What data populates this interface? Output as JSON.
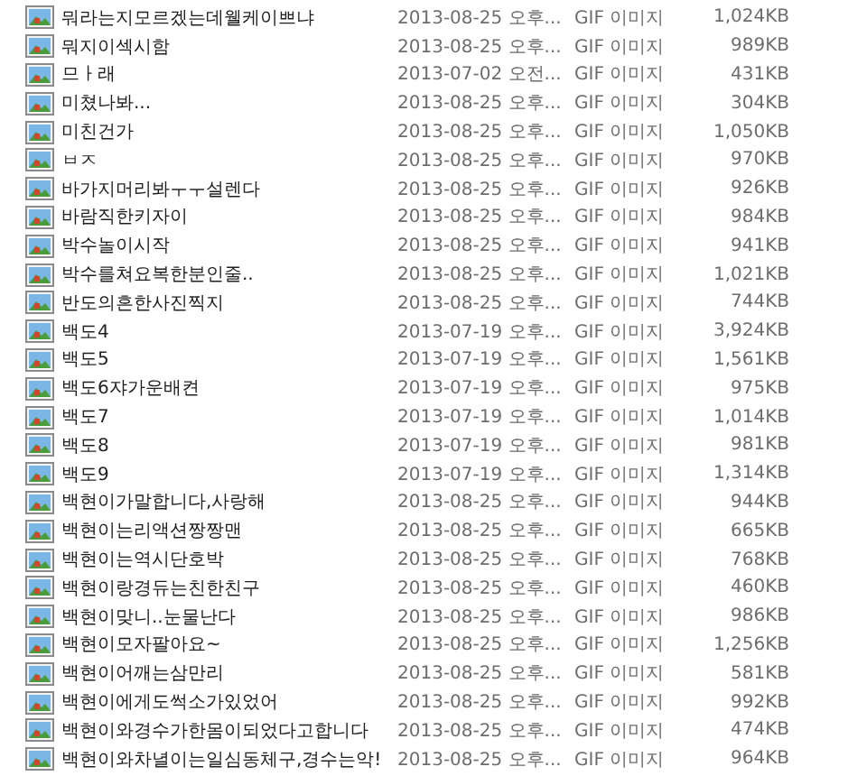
{
  "files": [
    {
      "name": "뭐라는지모르겠는데웰케이쁘냐",
      "date": "2013-08-25 오후...",
      "type": "GIF 이미지",
      "size": "1,024KB"
    },
    {
      "name": "뭐지이섹시함",
      "date": "2013-08-25 오후...",
      "type": "GIF 이미지",
      "size": "989KB"
    },
    {
      "name": "므ㅏ래",
      "date": "2013-07-02 오전...",
      "type": "GIF 이미지",
      "size": "431KB"
    },
    {
      "name": "미쳤나봐...",
      "date": "2013-08-25 오후...",
      "type": "GIF 이미지",
      "size": "304KB"
    },
    {
      "name": "미친건가",
      "date": "2013-08-25 오후...",
      "type": "GIF 이미지",
      "size": "1,050KB"
    },
    {
      "name": "ㅂㅈ",
      "date": "2013-08-25 오후...",
      "type": "GIF 이미지",
      "size": "970KB"
    },
    {
      "name": "바가지머리봐ㅜㅜ설렌다",
      "date": "2013-08-25 오후...",
      "type": "GIF 이미지",
      "size": "926KB"
    },
    {
      "name": "바람직한키자이",
      "date": "2013-08-25 오후...",
      "type": "GIF 이미지",
      "size": "984KB"
    },
    {
      "name": "박수놀이시작",
      "date": "2013-08-25 오후...",
      "type": "GIF 이미지",
      "size": "941KB"
    },
    {
      "name": "박수를쳐요복한분인줄..",
      "date": "2013-08-25 오후...",
      "type": "GIF 이미지",
      "size": "1,021KB"
    },
    {
      "name": "반도의흔한사진찍지",
      "date": "2013-08-25 오후...",
      "type": "GIF 이미지",
      "size": "744KB"
    },
    {
      "name": "백도4",
      "date": "2013-07-19 오후...",
      "type": "GIF 이미지",
      "size": "3,924KB"
    },
    {
      "name": "백도5",
      "date": "2013-07-19 오후...",
      "type": "GIF 이미지",
      "size": "1,561KB"
    },
    {
      "name": "백도6쟈가운배켠",
      "date": "2013-07-19 오후...",
      "type": "GIF 이미지",
      "size": "975KB"
    },
    {
      "name": "백도7",
      "date": "2013-07-19 오후...",
      "type": "GIF 이미지",
      "size": "1,014KB"
    },
    {
      "name": "백도8",
      "date": "2013-07-19 오후...",
      "type": "GIF 이미지",
      "size": "981KB"
    },
    {
      "name": "백도9",
      "date": "2013-07-19 오후...",
      "type": "GIF 이미지",
      "size": "1,314KB"
    },
    {
      "name": "백현이가말합니다,사랑해",
      "date": "2013-08-25 오후...",
      "type": "GIF 이미지",
      "size": "944KB"
    },
    {
      "name": "백현이는리액션짱짱맨",
      "date": "2013-08-25 오후...",
      "type": "GIF 이미지",
      "size": "665KB"
    },
    {
      "name": "백현이는역시단호박",
      "date": "2013-08-25 오후...",
      "type": "GIF 이미지",
      "size": "768KB"
    },
    {
      "name": "백현이랑경듀는친한친구",
      "date": "2013-08-25 오후...",
      "type": "GIF 이미지",
      "size": "460KB"
    },
    {
      "name": "백현이맞니..눈물난다",
      "date": "2013-08-25 오후...",
      "type": "GIF 이미지",
      "size": "986KB"
    },
    {
      "name": "백현이모자팔아요~",
      "date": "2013-08-25 오후...",
      "type": "GIF 이미지",
      "size": "1,256KB"
    },
    {
      "name": "백현이어깨는삼만리",
      "date": "2013-08-25 오후...",
      "type": "GIF 이미지",
      "size": "581KB"
    },
    {
      "name": "백현이에게도썩소가있었어",
      "date": "2013-08-25 오후...",
      "type": "GIF 이미지",
      "size": "992KB"
    },
    {
      "name": "백현이와경수가한몸이되었다고합니다",
      "date": "2013-08-25 오후...",
      "type": "GIF 이미지",
      "size": "474KB"
    },
    {
      "name": "백현이와차녈이는일심동체구,경수는악!",
      "date": "2013-08-25 오후...",
      "type": "GIF 이미지",
      "size": "964KB"
    }
  ]
}
